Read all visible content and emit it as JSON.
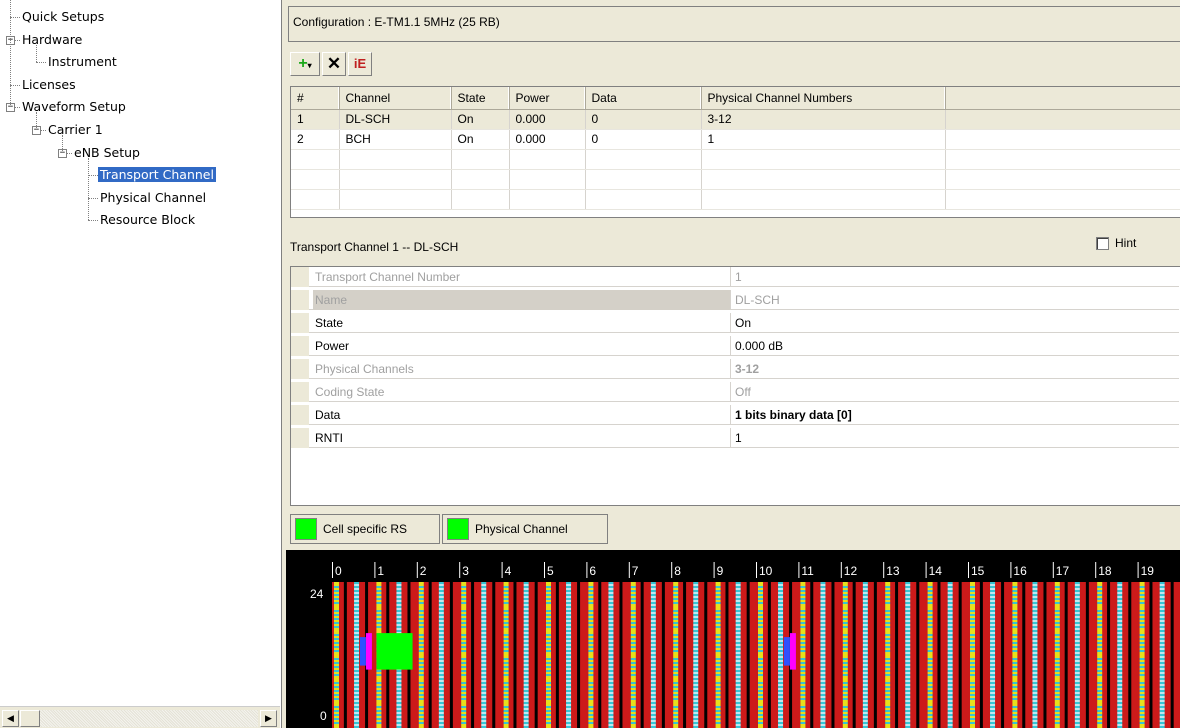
{
  "tree": {
    "items": [
      {
        "label": "Quick Setups",
        "level": 0,
        "expander": "none"
      },
      {
        "label": "Hardware",
        "level": 0,
        "expander": "minus"
      },
      {
        "label": "Instrument",
        "level": 1,
        "expander": "none"
      },
      {
        "label": "Licenses",
        "level": 0,
        "expander": "none"
      },
      {
        "label": "Waveform Setup",
        "level": 0,
        "expander": "minus"
      },
      {
        "label": "Carrier 1",
        "level": 1,
        "expander": "minus"
      },
      {
        "label": "eNB Setup",
        "level": 2,
        "expander": "minus"
      },
      {
        "label": "Transport Channel",
        "level": 3,
        "expander": "none",
        "selected": true
      },
      {
        "label": "Physical Channel",
        "level": 3,
        "expander": "none"
      },
      {
        "label": "Resource Block",
        "level": 3,
        "expander": "none"
      }
    ],
    "scroll_left_icon": "arrow-left-icon",
    "scroll_right_icon": "arrow-right-icon"
  },
  "config": {
    "label": "Configuration : E-TM1.1 5MHz (25 RB)"
  },
  "toolbar": {
    "add_icon": "add-dropdown-icon",
    "delete_icon": "delete-x-icon",
    "ie_icon": "ie-icon"
  },
  "channel_table": {
    "headers": [
      "#",
      "Channel",
      "State",
      "Power",
      "Data",
      "Physical Channel Numbers",
      ""
    ],
    "rows": [
      [
        "1",
        "DL-SCH",
        "On",
        "0.000",
        "0",
        "3-12",
        ""
      ],
      [
        "2",
        "BCH",
        "On",
        "0.000",
        "0",
        "1",
        ""
      ],
      [
        "",
        "",
        "",
        "",
        "",
        "",
        ""
      ],
      [
        "",
        "",
        "",
        "",
        "",
        "",
        ""
      ],
      [
        "",
        "",
        "",
        "",
        "",
        "",
        ""
      ]
    ]
  },
  "transport": {
    "title": "Transport Channel 1 -- DL-SCH",
    "hint_label": "Hint"
  },
  "properties": [
    {
      "name": "Transport Channel Number",
      "value": "1",
      "readonly": true,
      "bold": false
    },
    {
      "name": "Name",
      "value": "DL-SCH",
      "readonly": true,
      "bold": false,
      "selected": true
    },
    {
      "name": "State",
      "value": "On",
      "readonly": false,
      "bold": false
    },
    {
      "name": "Power",
      "value": "0.000 dB",
      "readonly": false,
      "bold": false
    },
    {
      "name": "Physical Channels",
      "value": "3-12",
      "readonly": true,
      "bold": true
    },
    {
      "name": "Coding State",
      "value": "Off",
      "readonly": true,
      "bold": false
    },
    {
      "name": "Data",
      "value": "1 bits binary data [0]",
      "readonly": false,
      "bold": true
    },
    {
      "name": "RNTI",
      "value": "1",
      "readonly": false,
      "bold": false
    }
  ],
  "legend": [
    {
      "label": "Cell specific RS",
      "color": "#00ff00"
    },
    {
      "label": "Physical Channel",
      "color": "#00ff00"
    }
  ],
  "resource_grid": {
    "subframe_labels": [
      "0",
      "1",
      "2",
      "3",
      "4",
      "5",
      "6",
      "7",
      "8",
      "9",
      "10",
      "11",
      "12",
      "13",
      "14",
      "15",
      "16",
      "17",
      "18",
      "19"
    ],
    "y_top_label": "24",
    "y_bottom_label": "0",
    "colors": {
      "background": "#cc1a1a",
      "rs_cyan": "#36c5d6",
      "rs_yellow": "#e6e01e",
      "magenta": "#ff00ff",
      "blue": "#3050ff",
      "green": "#00ff00"
    }
  }
}
